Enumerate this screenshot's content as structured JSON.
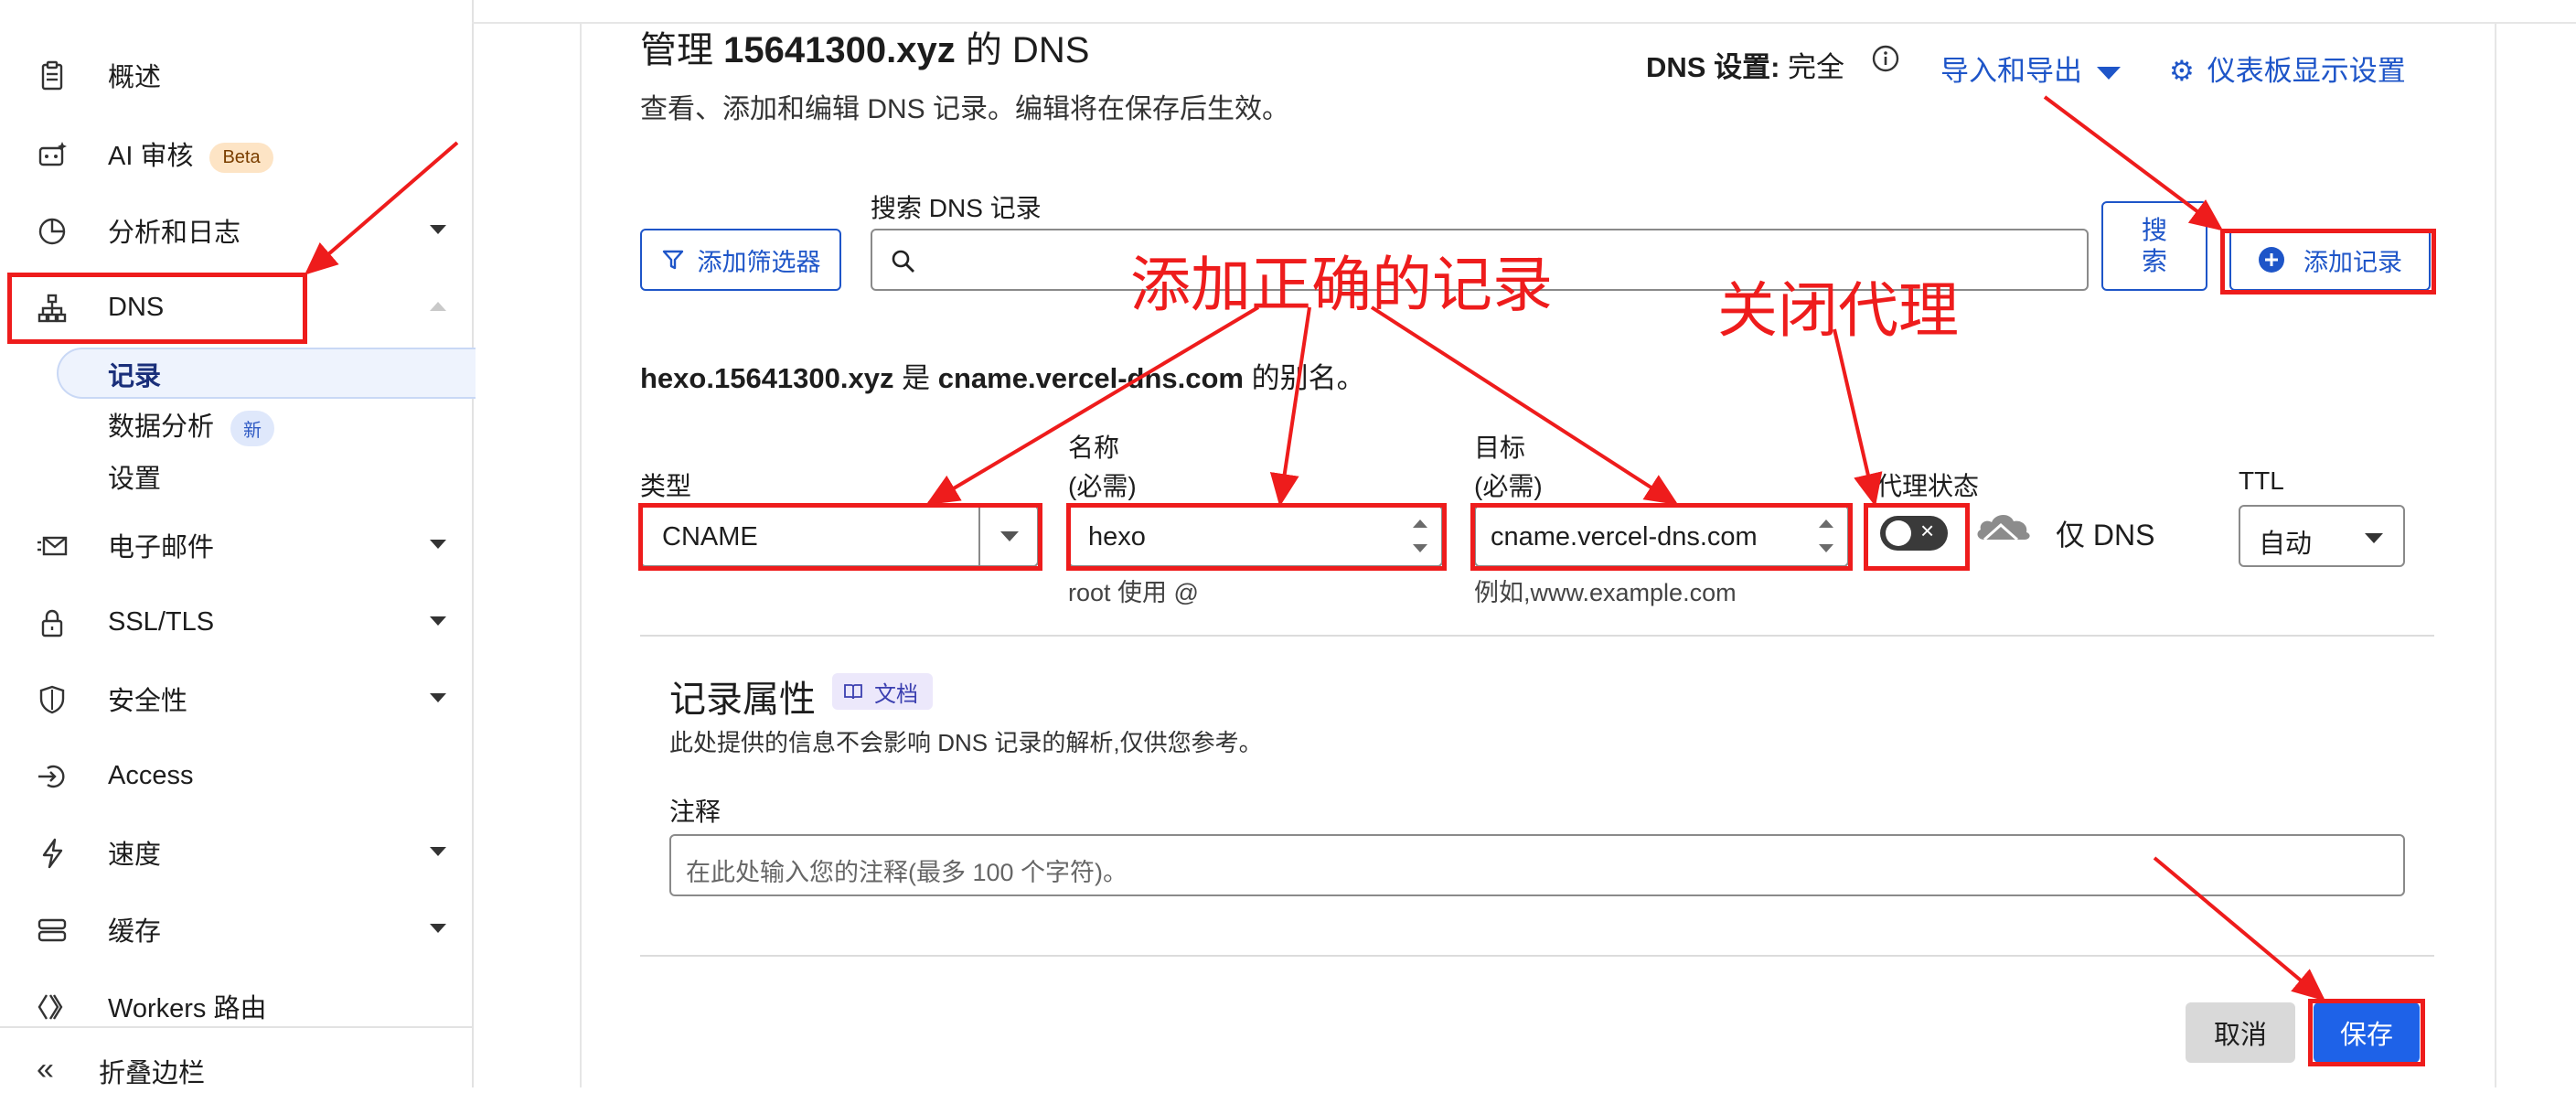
{
  "sidebar": {
    "items": [
      {
        "label": "概述",
        "icon": "clipboard-icon"
      },
      {
        "label": "AI 审核",
        "icon": "ai-bot-icon",
        "badge": "Beta"
      },
      {
        "label": "分析和日志",
        "icon": "pie-chart-icon"
      },
      {
        "label": "DNS",
        "icon": "network-icon"
      },
      {
        "label": "电子邮件",
        "icon": "mail-icon"
      },
      {
        "label": "SSL/TLS",
        "icon": "lock-icon"
      },
      {
        "label": "安全性",
        "icon": "shield-icon"
      },
      {
        "label": "Access",
        "icon": "access-icon"
      },
      {
        "label": "速度",
        "icon": "bolt-icon"
      },
      {
        "label": "缓存",
        "icon": "storage-icon"
      },
      {
        "label": "Workers 路由",
        "icon": "workers-icon"
      }
    ],
    "dns_sub": [
      {
        "label": "记录"
      },
      {
        "label": "数据分析",
        "badge": "新"
      },
      {
        "label": "设置"
      }
    ],
    "collapse_label": "折叠边栏"
  },
  "header": {
    "title_prefix": "管理 ",
    "title_domain": "15641300.xyz",
    "title_suffix": " 的 DNS",
    "subtitle": "查看、添加和编辑 DNS 记录。编辑将在保存后生效。",
    "dns_setting_label": "DNS 设置:",
    "dns_setting_value": "完全",
    "import_export": "导入和导出",
    "dashboard_settings": "仪表板显示设置"
  },
  "toolbar": {
    "filter_button": "添加筛选器",
    "search_label": "搜索 DNS 记录",
    "search_value": "",
    "search_button_line1": "搜",
    "search_button_line2": "索",
    "add_record_button": "添加记录"
  },
  "alias_note": {
    "name": "hexo.15641300.xyz",
    "is": " 是 ",
    "target": "cname.vercel-dns.com",
    "suffix": " 的别名。"
  },
  "form": {
    "type_label": "类型",
    "type_value": "CNAME",
    "name_label": "名称",
    "name_required": "(必需)",
    "name_value": "hexo",
    "name_hint": "root 使用 @",
    "target_label": "目标",
    "target_required": "(必需)",
    "target_value": "cname.vercel-dns.com",
    "target_hint": "例如,www.example.com",
    "proxy_label": "代理状态",
    "proxy_value": "仅 DNS",
    "proxy_on": false,
    "ttl_label": "TTL",
    "ttl_value": "自动"
  },
  "record_props": {
    "title": "记录属性",
    "docs": "文档",
    "desc": "此处提供的信息不会影响 DNS 记录的解析,仅供您参考。",
    "comment_label": "注释",
    "comment_placeholder": "在此处输入您的注释(最多 100 个字符)。"
  },
  "actions": {
    "cancel": "取消",
    "save": "保存"
  },
  "annotations": {
    "add_correct_record": "添加正确的记录",
    "close_proxy": "关闭代理",
    "color": "#ee1c1c"
  },
  "colors": {
    "accent": "#1e55c8",
    "save_bg": "#1e62e8",
    "annotation": "#ee1c1c"
  }
}
